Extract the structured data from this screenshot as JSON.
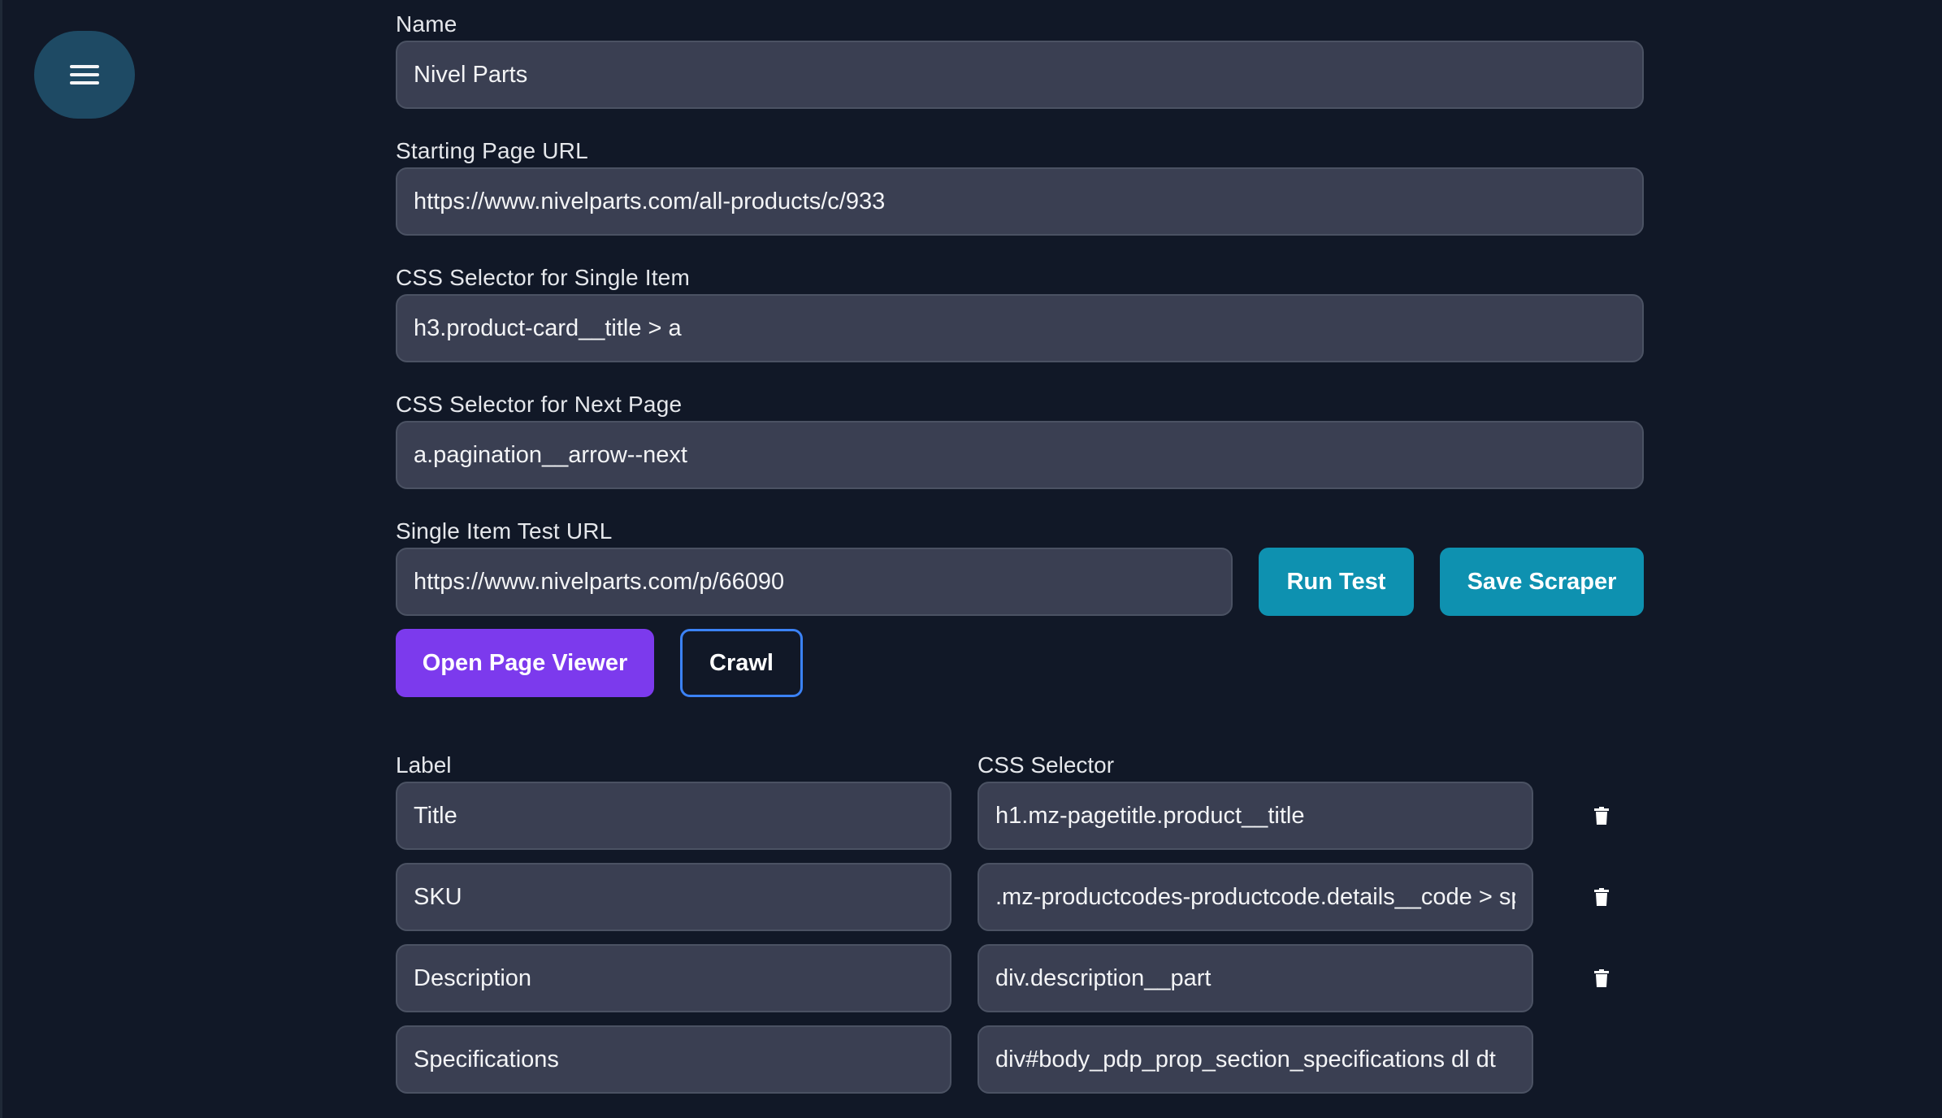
{
  "menu": {
    "icon": "hamburger-menu-icon"
  },
  "form": {
    "name": {
      "label": "Name",
      "value": "Nivel Parts"
    },
    "starting_url": {
      "label": "Starting Page URL",
      "value": "https://www.nivelparts.com/all-products/c/933"
    },
    "single_item_selector": {
      "label": "CSS Selector for Single Item",
      "value": "h3.product-card__title > a"
    },
    "next_page_selector": {
      "label": "CSS Selector for Next Page",
      "value": "a.pagination__arrow--next"
    },
    "test_url": {
      "label": "Single Item Test URL",
      "value": "https://www.nivelparts.com/p/66090"
    }
  },
  "buttons": {
    "run_test": "Run Test",
    "save_scraper": "Save Scraper",
    "open_page_viewer": "Open Page Viewer",
    "crawl": "Crawl"
  },
  "fields_table": {
    "headers": {
      "label": "Label",
      "selector": "CSS Selector"
    },
    "rows": [
      {
        "label": "Title",
        "selector": "h1.mz-pagetitle.product__title",
        "deletable": true
      },
      {
        "label": "SKU",
        "selector": ".mz-productcodes-productcode.details__code > span",
        "deletable": true
      },
      {
        "label": "Description",
        "selector": "div.description__part",
        "deletable": true
      },
      {
        "label": "Specifications",
        "selector": "div#body_pdp_prop_section_specifications dl dt",
        "deletable": false
      }
    ]
  },
  "colors": {
    "background": "#111827",
    "input_bg": "#3a3f52",
    "teal_button": "#0e91b0",
    "purple_button": "#7c3aed",
    "menu_button": "#1e4a64"
  }
}
